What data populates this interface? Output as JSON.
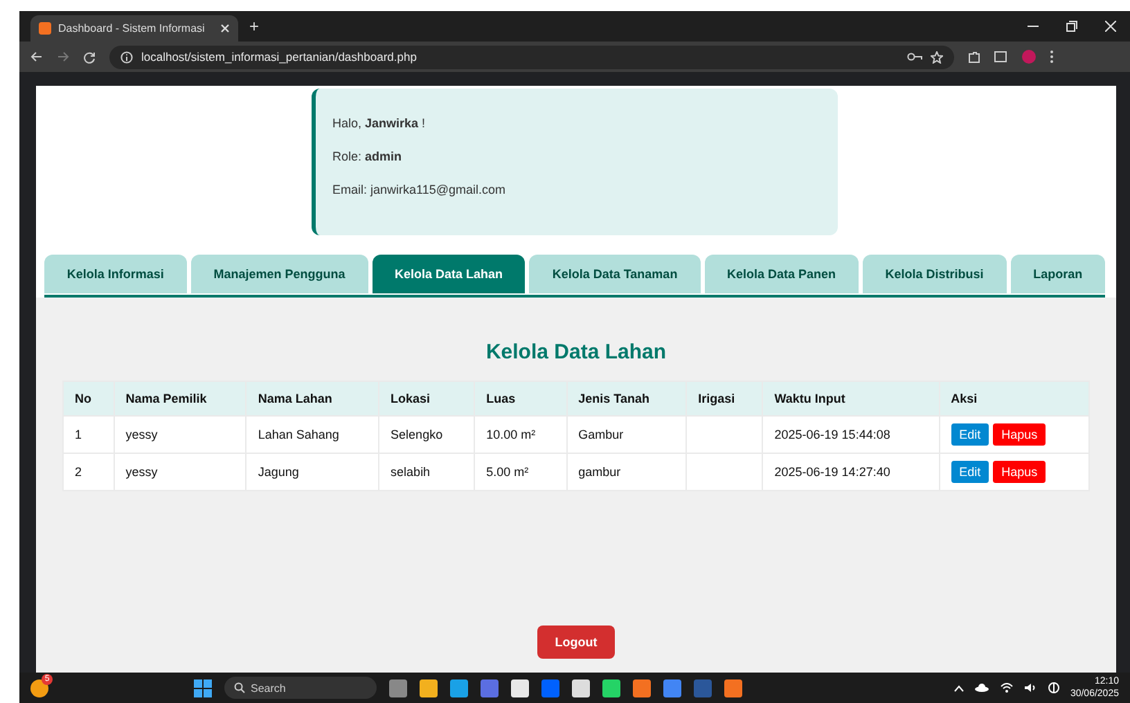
{
  "browser": {
    "tab_title": "Dashboard - Sistem Informasi",
    "new_tab": "+",
    "url": "localhost/sistem_informasi_pertanian/dashboard.php"
  },
  "profile": {
    "greeting": "Halo, **Janwirka** !",
    "role": "Role: **admin**",
    "email": "Email: janwirka115@gmail.com"
  },
  "tabs": [
    {
      "label": "Kelola Informasi",
      "selected": false
    },
    {
      "label": "Manajemen Pengguna",
      "selected": false
    },
    {
      "label": "Kelola Data Lahan",
      "selected": true
    },
    {
      "label": "Kelola Data Tanaman",
      "selected": false
    },
    {
      "label": "Kelola Data Panen",
      "selected": false
    },
    {
      "label": "Kelola Distribusi",
      "selected": false
    },
    {
      "label": "Laporan",
      "selected": false
    }
  ],
  "section_title": "Kelola Data Lahan",
  "table": {
    "columns": [
      "No",
      "Nama Pemilik",
      "Nama Lahan",
      "Lokasi",
      "Luas",
      "Jenis Tanah",
      "Irigasi",
      "Waktu Input",
      "Aksi"
    ],
    "rows": [
      {
        "cells": [
          "1",
          "yessy",
          "Lahan Sahang",
          "Selengko",
          "10.00 m²",
          "Gambur",
          "",
          "2025-06-19 15:44:08"
        ],
        "actions": [
          "Edit",
          "Hapus"
        ]
      },
      {
        "cells": [
          "2",
          "yessy",
          "Jagung",
          "selabih",
          "5.00 m²",
          "gambur",
          "",
          "2025-06-19 14:27:40"
        ],
        "actions": [
          "Edit",
          "Hapus"
        ]
      }
    ]
  },
  "logout": "Logout",
  "taskbar": {
    "search_placeholder": "Search",
    "notification_badge": "5",
    "time": "12:10",
    "date": "30/06/2025"
  }
}
